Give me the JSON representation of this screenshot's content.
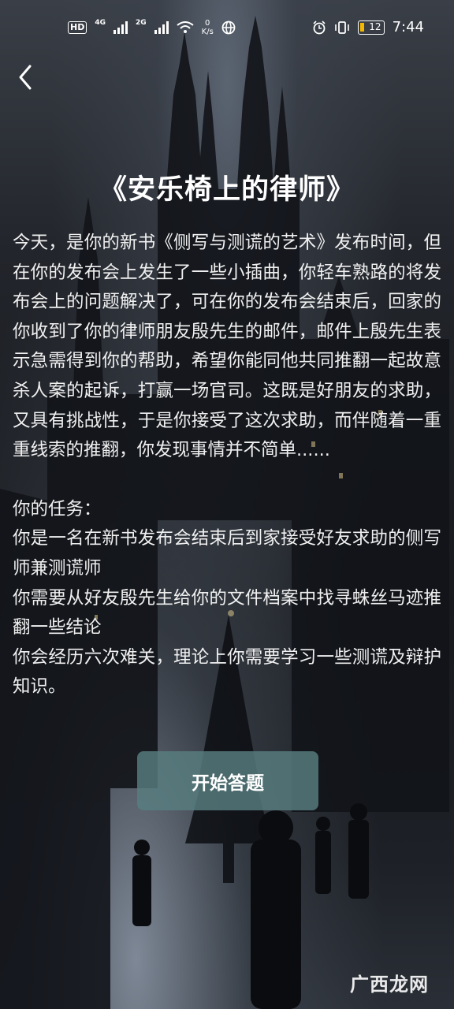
{
  "status_bar": {
    "hd": "HD",
    "network1": "4G",
    "network2": "2G",
    "speed_value": "0",
    "speed_unit": "K/s",
    "battery": "12",
    "time": "7:44"
  },
  "title": "《安乐椅上的律师》",
  "intro": "今天，是你的新书《侧写与测谎的艺术》发布时间，但在你的发布会上发生了一些小插曲，你轻车熟路的将发布会上的问题解决了，可在你的发布会结束后，回家的你收到了你的律师朋友殷先生的邮件，邮件上殷先生表示急需得到你的帮助，希望你能同他共同推翻一起故意杀人案的起诉，打赢一场官司。这既是好朋友的求助，又具有挑战性，于是你接受了这次求助，而伴随着一重重线索的推翻，你发现事情并不简单......",
  "tasks": {
    "heading": "你的任务：",
    "items": [
      "你是一名在新书发布会结束后到家接受好友求助的侧写师兼测谎师",
      "你需要从好友殷先生给你的文件档案中找寻蛛丝马迹推翻一些结论",
      "你会经历六次难关，理论上你需要学习一些测谎及辩护知识。"
    ]
  },
  "start_button": "开始答题",
  "watermark": "广西龙网"
}
